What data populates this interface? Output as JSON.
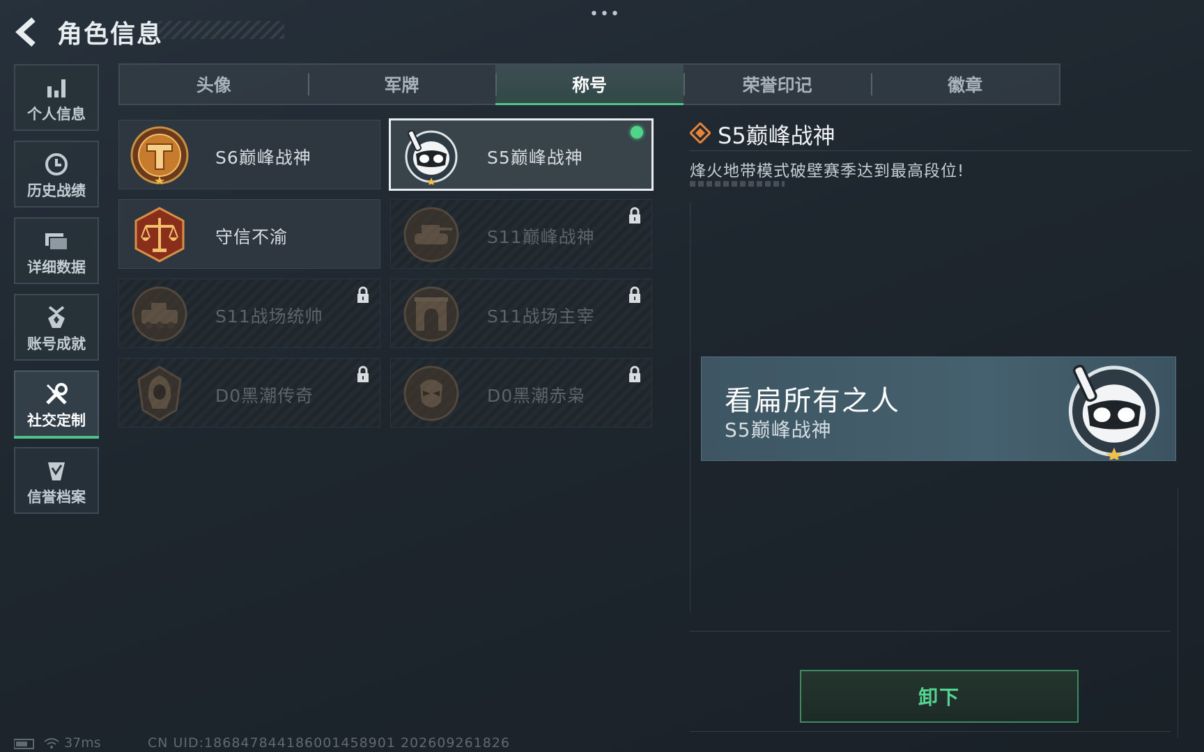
{
  "header": {
    "title": "角色信息",
    "more": "•••"
  },
  "sidebar": {
    "items": [
      {
        "label": "个人信息",
        "icon": "bar-chart-icon"
      },
      {
        "label": "历史战绩",
        "icon": "clock-icon"
      },
      {
        "label": "详细数据",
        "icon": "folder-icon"
      },
      {
        "label": "账号成就",
        "icon": "medal-icon"
      },
      {
        "label": "社交定制",
        "icon": "tools-icon",
        "active": true
      },
      {
        "label": "信誉档案",
        "icon": "shield-check-icon"
      }
    ]
  },
  "tabs": [
    {
      "label": "头像"
    },
    {
      "label": "军牌"
    },
    {
      "label": "称号",
      "active": true
    },
    {
      "label": "荣誉印记"
    },
    {
      "label": "徽章"
    }
  ],
  "titles": [
    {
      "label": "S6巅峰战神",
      "state": "unlocked",
      "emblem": "gold-t-emblem"
    },
    {
      "label": "S5巅峰战神",
      "state": "selected",
      "emblem": "diver-skull-emblem"
    },
    {
      "label": "守信不渝",
      "state": "unlocked",
      "emblem": "scales-emblem"
    },
    {
      "label": "S11巅峰战神",
      "state": "locked",
      "emblem": "tank-emblem"
    },
    {
      "label": "S11战场统帅",
      "state": "locked",
      "emblem": "apc-emblem"
    },
    {
      "label": "S11战场主宰",
      "state": "locked",
      "emblem": "arch-emblem"
    },
    {
      "label": "D0黑潮传奇",
      "state": "locked",
      "emblem": "hooded-figure-emblem"
    },
    {
      "label": "D0黑潮赤枭",
      "state": "locked",
      "emblem": "masked-face-emblem"
    }
  ],
  "detail": {
    "title": "S5巅峰战神",
    "description": "烽火地带模式破壁赛季达到最高段位!"
  },
  "preview": {
    "player_name": "看扁所有之人",
    "title": "S5巅峰战神"
  },
  "actions": {
    "unequip_label": "卸下"
  },
  "status": {
    "ping": "37ms",
    "uid": "CN UID:18684784418600145890​1 202609261826"
  },
  "colors": {
    "accent_green": "#4fc28a",
    "equipped_dot": "#4fd58a",
    "background": "#1e262e"
  }
}
